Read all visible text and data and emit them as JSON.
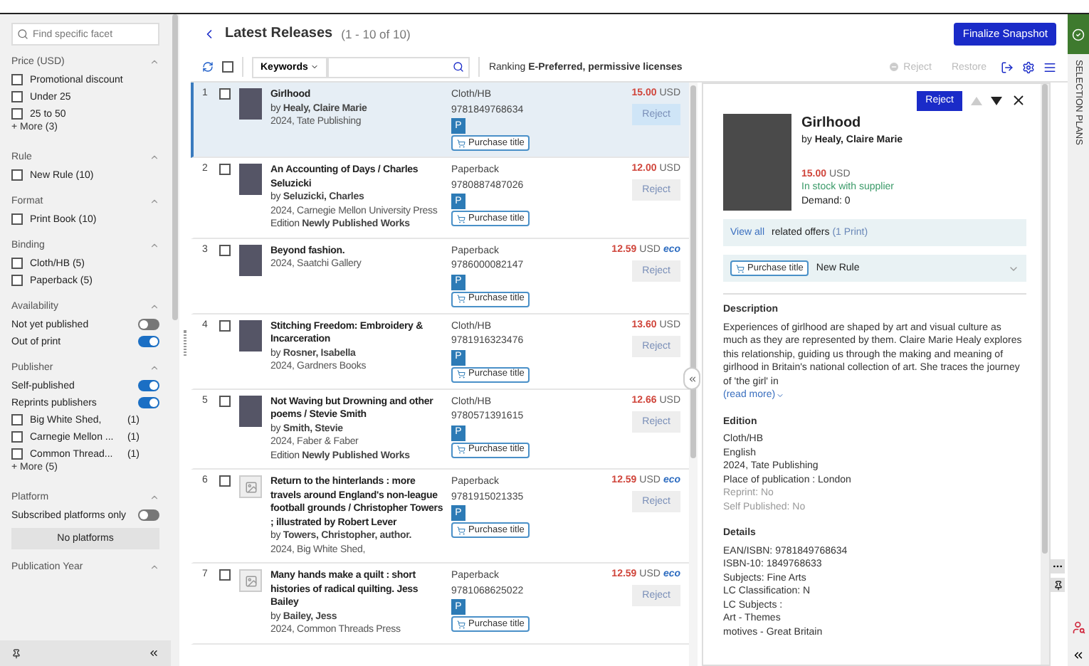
{
  "sidebar": {
    "search": {
      "placeholder": "Find specific facet"
    },
    "sections": [
      {
        "title": "Price (USD)",
        "items": [
          {
            "kind": "checkbox",
            "label": "Promotional discount",
            "checked": false
          },
          {
            "kind": "checkbox",
            "label": "Under 25",
            "checked": false
          },
          {
            "kind": "checkbox",
            "label": "25 to 50",
            "checked": false
          },
          {
            "kind": "more",
            "label": "+ More (3)"
          }
        ]
      },
      {
        "title": "Rule",
        "items": [
          {
            "kind": "checkbox",
            "label": "New Rule (10)",
            "checked": false
          }
        ]
      },
      {
        "title": "Format",
        "items": [
          {
            "kind": "checkbox",
            "label": "Print Book (10)",
            "checked": false
          }
        ]
      },
      {
        "title": "Binding",
        "items": [
          {
            "kind": "checkbox",
            "label": "Cloth/HB (5)",
            "checked": false
          },
          {
            "kind": "checkbox",
            "label": "Paperback (5)",
            "checked": false
          }
        ]
      },
      {
        "title": "Availability",
        "items": [
          {
            "kind": "toggle",
            "label": "Not yet published",
            "on": false
          },
          {
            "kind": "toggle",
            "label": "Out of print",
            "on": true
          }
        ]
      },
      {
        "title": "Publisher",
        "items": [
          {
            "kind": "toggle",
            "label": "Self-published",
            "on": true
          },
          {
            "kind": "toggle",
            "label": "Reprints publishers",
            "on": true
          },
          {
            "kind": "checkbox",
            "label": "Big White Shed,",
            "count": "(1)",
            "checked": false
          },
          {
            "kind": "checkbox",
            "label": "Carnegie Mellon ...",
            "count": "(1)",
            "checked": false
          },
          {
            "kind": "checkbox",
            "label": "Common Thread...",
            "count": "(1)",
            "checked": false
          },
          {
            "kind": "more",
            "label": "+ More (5)"
          }
        ]
      },
      {
        "title": "Platform",
        "items": [
          {
            "kind": "toggle",
            "label": "Subscribed platforms only",
            "on": false
          },
          {
            "kind": "note",
            "label": "No platforms"
          }
        ]
      },
      {
        "title": "Publication Year"
      }
    ]
  },
  "header": {
    "title": "Latest Releases",
    "range": "(1 - 10 of 10)",
    "finalize": "Finalize Snapshot"
  },
  "toolbar": {
    "select_all": {
      "checked": false
    },
    "search_scope": "Keywords",
    "ranking_label": "Ranking",
    "ranking_value": "E-Preferred, permissive licenses",
    "actions": [
      {
        "kind": "reject",
        "label": "Reject",
        "disabled": true
      },
      {
        "kind": "restore",
        "label": "Restore",
        "disabled": true
      }
    ]
  },
  "list": {
    "rows": [
      {
        "number": "1",
        "has_cover": true,
        "title": "Girlhood",
        "author": "by **Healy, Claire Marie**",
        "published": "2024, Tate Publishing",
        "format": "Cloth/HB",
        "isbn": "9781849768634",
        "badge": "P",
        "purchase": "Purchase title",
        "price": "15.00",
        "currency": "USD",
        "action": "Reject",
        "selected": true,
        "checked": false
      },
      {
        "number": "2",
        "has_cover": true,
        "title": "An Accounting of Days / Charles Seluzicki",
        "author": "by **Seluzicki, Charles**",
        "published": "2024, Carnegie Mellon University Press",
        "edition": "Edition **Newly Published Works**",
        "format": "Paperback",
        "isbn": "9780887487026",
        "badge": "P",
        "purchase": "Purchase title",
        "price": "12.00",
        "currency": "USD",
        "action": "Reject",
        "selected": false,
        "checked": false
      },
      {
        "number": "3",
        "has_cover": true,
        "title": "Beyond fashion.",
        "published": "2024, Saatchi Gallery",
        "format": "Paperback",
        "isbn": "9786000082147",
        "badge": "P",
        "purchase": "Purchase title",
        "price": "12.59",
        "currency": "USD",
        "eco": "eco",
        "action": "Reject",
        "selected": false,
        "checked": false
      },
      {
        "number": "4",
        "has_cover": true,
        "title": "Stitching Freedom: Embroidery & Incarceration",
        "author": "by **Rosner, Isabella**",
        "published": "2024, Gardners Books",
        "format": "Cloth/HB",
        "isbn": "9781916323476",
        "badge": "P",
        "purchase": "Purchase title",
        "price": "13.60",
        "currency": "USD",
        "action": "Reject",
        "selected": false,
        "checked": false
      },
      {
        "number": "5",
        "has_cover": true,
        "title": "Not Waving but Drowning and other poems / Stevie Smith",
        "author": "by **Smith, Stevie**",
        "published": "2024, Faber & Faber",
        "edition": "Edition **Newly Published Works**",
        "format": "Cloth/HB",
        "isbn": "9780571391615",
        "badge": "P",
        "purchase": "Purchase title",
        "price": "12.66",
        "currency": "USD",
        "action": "Reject",
        "selected": false,
        "checked": false
      },
      {
        "number": "6",
        "has_cover": false,
        "title": "Return to the hinterlands : more travels around England's non-league football grounds / Christopher Towers ; illustrated by Robert Lever",
        "author": "by **Towers, Christopher, author.**",
        "published": "2024, Big White Shed,",
        "format": "Paperback",
        "isbn": "9781915021335",
        "badge": "P",
        "purchase": "Purchase title",
        "price": "12.59",
        "currency": "USD",
        "eco": "eco",
        "action": "Reject",
        "selected": false,
        "checked": false
      },
      {
        "number": "7",
        "has_cover": false,
        "title": "Many hands make a quilt : short histories of radical quilting. Jess Bailey",
        "author": "by **Bailey, Jess**",
        "published": "2024, Common Threads Press",
        "format": "Paperback",
        "isbn": "9781068625022",
        "badge": "P",
        "purchase": "Purchase title",
        "price": "12.59",
        "currency": "USD",
        "eco": "eco",
        "action": "Reject",
        "selected": false,
        "checked": false
      }
    ]
  },
  "detail": {
    "action": "Reject",
    "title": "Girlhood",
    "author": "by **Healy, Claire Marie**",
    "price": "15.00",
    "currency": "USD",
    "stock": "In stock with supplier",
    "demand": "Demand: 0",
    "related": {
      "link": "View all",
      "label": "related offers",
      "count": "(1 Print)"
    },
    "rule": {
      "tag": "Purchase title",
      "label": "New Rule"
    },
    "description": {
      "heading": "Description",
      "text": "Experiences of girlhood are shaped by art and visual culture as much as they are represented by them. Claire Marie Healy explores this relationship, guiding us through the making and meaning of girlhood in Britain's national collection of art. She traces the journey of 'the girl' in",
      "more": "(read more)"
    },
    "sections": [
      {
        "heading": "Edition",
        "lines": [
          {
            "text": "Cloth/HB",
            "muted": false
          },
          {
            "text": "English",
            "muted": false
          },
          {
            "text": "2024, Tate Publishing",
            "muted": false
          },
          {
            "text": "Place of publication : London",
            "muted": false
          },
          {
            "text": "Reprint: No",
            "muted": true
          },
          {
            "text": "Self Published: No",
            "muted": true
          }
        ]
      },
      {
        "heading": "Details",
        "lines": [
          {
            "text": "EAN/ISBN: 9781849768634",
            "muted": false
          },
          {
            "text": "ISBN-10: 1849768633",
            "muted": false
          },
          {
            "text": "Subjects: Fine Arts",
            "muted": false
          },
          {
            "text": "LC Classification: N",
            "muted": false
          },
          {
            "text": "LC Subjects :",
            "muted": false
          },
          {
            "text": "Art - Themes",
            "muted": false
          },
          {
            "text": "motives - Great Britain",
            "muted": false
          }
        ]
      }
    ]
  },
  "rail": {
    "label": "SELECTION PLANS"
  }
}
